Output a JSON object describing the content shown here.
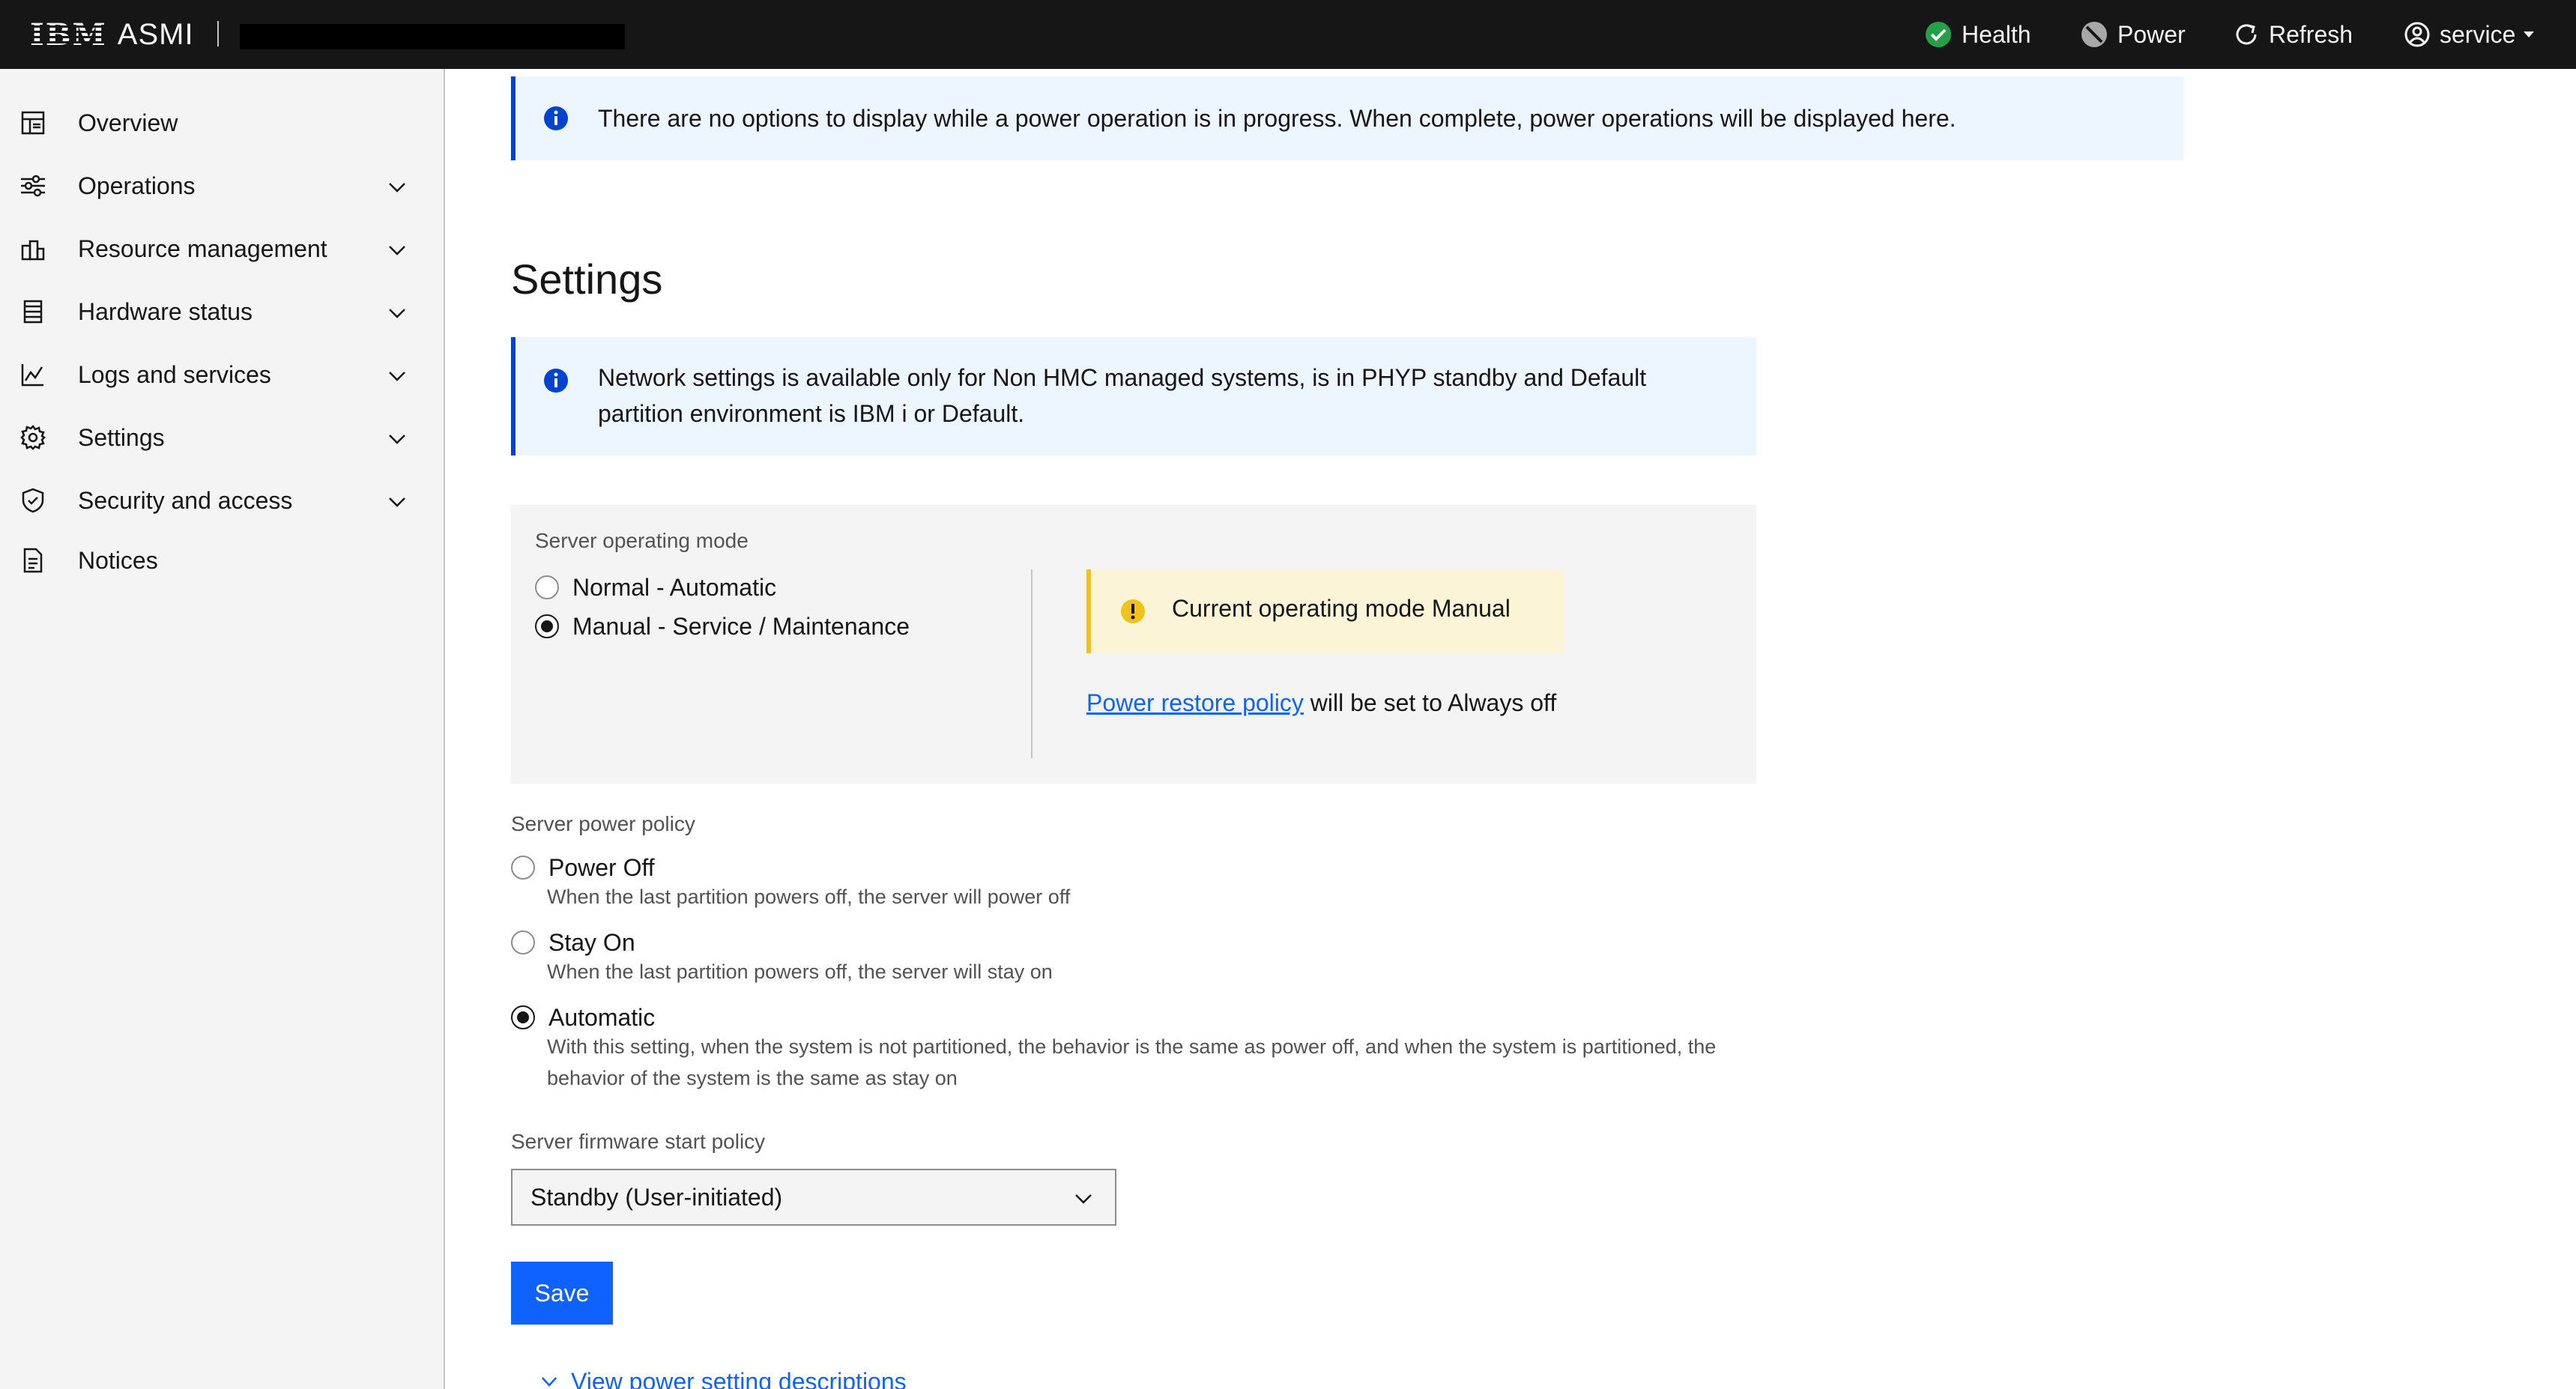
{
  "header": {
    "logo_ibm": "IBM",
    "logo_app": "ASMI",
    "health_label": "Health",
    "power_label": "Power",
    "refresh_label": "Refresh",
    "user_label": "service"
  },
  "colors": {
    "header_bg": "#161616",
    "accent": "#0f62fe",
    "info_border": "#0043ce",
    "warning": "#f1c21b",
    "health_ok": "#24a148"
  },
  "sidebar": {
    "items": [
      {
        "label": "Overview",
        "icon": "dashboard-icon",
        "expandable": false
      },
      {
        "label": "Operations",
        "icon": "sliders-icon",
        "expandable": true
      },
      {
        "label": "Resource management",
        "icon": "chart-icon",
        "expandable": true
      },
      {
        "label": "Hardware status",
        "icon": "server-icon",
        "expandable": true
      },
      {
        "label": "Logs and services",
        "icon": "chart-line-icon",
        "expandable": true
      },
      {
        "label": "Settings",
        "icon": "gear-icon",
        "expandable": true
      },
      {
        "label": "Security and access",
        "icon": "shield-icon",
        "expandable": true
      },
      {
        "label": "Notices",
        "icon": "document-icon",
        "expandable": false
      }
    ]
  },
  "main": {
    "power_notice": "There are no options to display while a power operation is in progress. When complete, power operations will be displayed here.",
    "title": "Settings",
    "network_notice": "Network settings is available only for Non HMC managed systems, is in PHYP standby and Default partition environment is IBM i or Default.",
    "operating_mode": {
      "label": "Server operating mode",
      "options": [
        {
          "label": "Normal - Automatic",
          "checked": false
        },
        {
          "label": "Manual - Service / Maintenance",
          "checked": true
        }
      ],
      "warning": "Current operating mode Manual",
      "restore_link": "Power restore policy",
      "restore_suffix": " will be set to Always off"
    },
    "power_policy": {
      "label": "Server power policy",
      "options": [
        {
          "label": "Power Off",
          "desc": "When the last partition powers off, the server will power off",
          "checked": false
        },
        {
          "label": "Stay On",
          "desc": "When the last partition powers off, the server will stay on",
          "checked": false
        },
        {
          "label": "Automatic",
          "desc": "With this setting, when the system is not partitioned, the behavior is the same as power off, and when the system is partitioned, the behavior of the system is the same as stay on",
          "checked": true
        }
      ]
    },
    "firmware_policy": {
      "label": "Server firmware start policy",
      "value": "Standby (User-initiated)"
    },
    "save_label": "Save",
    "view_link": "View power setting descriptions"
  }
}
